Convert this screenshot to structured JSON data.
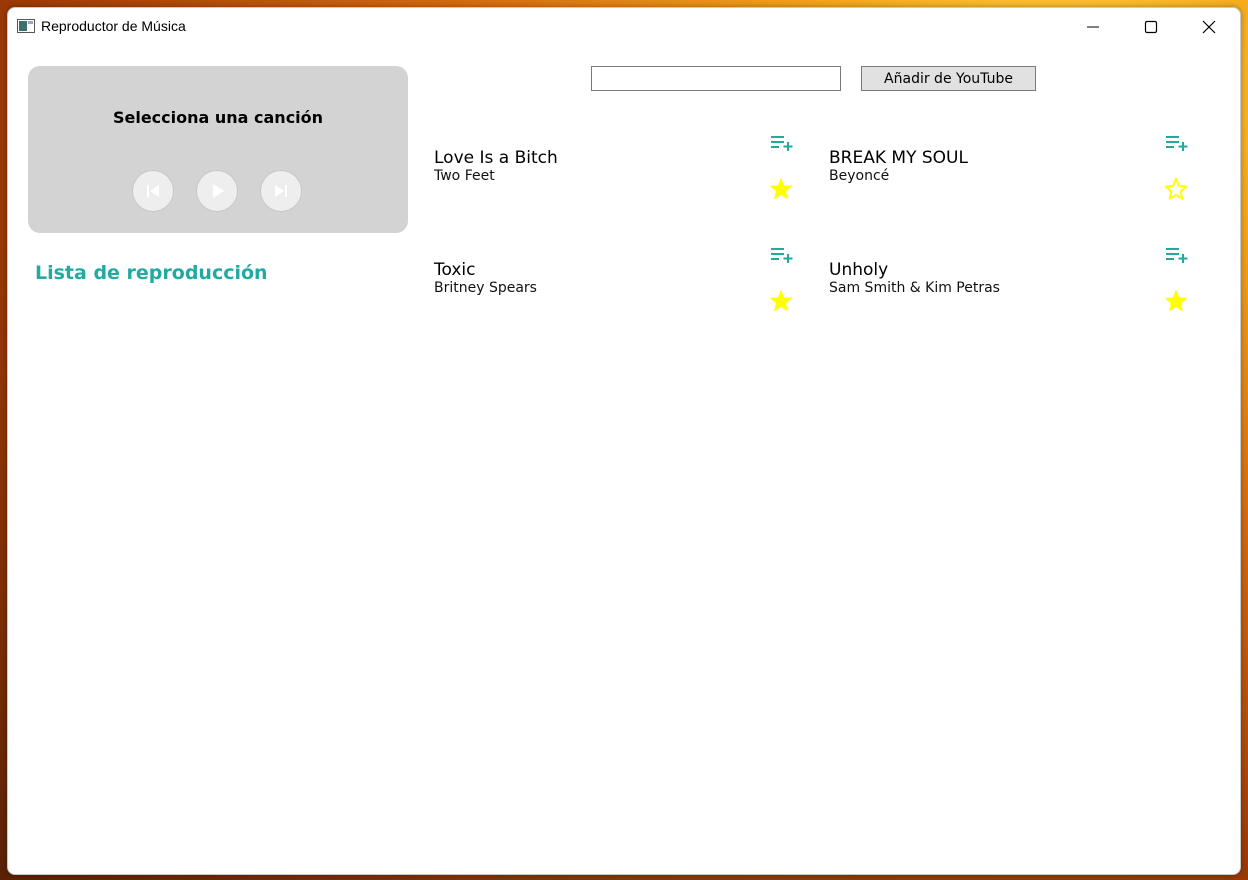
{
  "window": {
    "title": "Reproductor de Música",
    "controls": {
      "minimize": "minimize-icon",
      "maximize": "maximize-icon",
      "close": "close-icon"
    }
  },
  "player": {
    "now_playing": "Selecciona una canción",
    "controls": [
      "previous-icon",
      "play-icon",
      "next-icon"
    ]
  },
  "sidebar": {
    "playlist_heading": "Lista de reproducción"
  },
  "youtube": {
    "input_value": "",
    "button_label": "Añadir de YouTube"
  },
  "songs": [
    {
      "title": "Love Is a Bitch",
      "artist": "Two Feet",
      "favorite": true
    },
    {
      "title": "BREAK MY SOUL",
      "artist": "Beyoncé",
      "favorite": false
    },
    {
      "title": "Toxic",
      "artist": "Britney Spears",
      "favorite": true
    },
    {
      "title": "Unholy",
      "artist": "Sam Smith & Kim Petras",
      "favorite": true
    }
  ],
  "colors": {
    "accent": "#22aaa1",
    "star": "#ffff00",
    "player_background": "#d3d3d3",
    "player_button": "#eeeeee"
  }
}
